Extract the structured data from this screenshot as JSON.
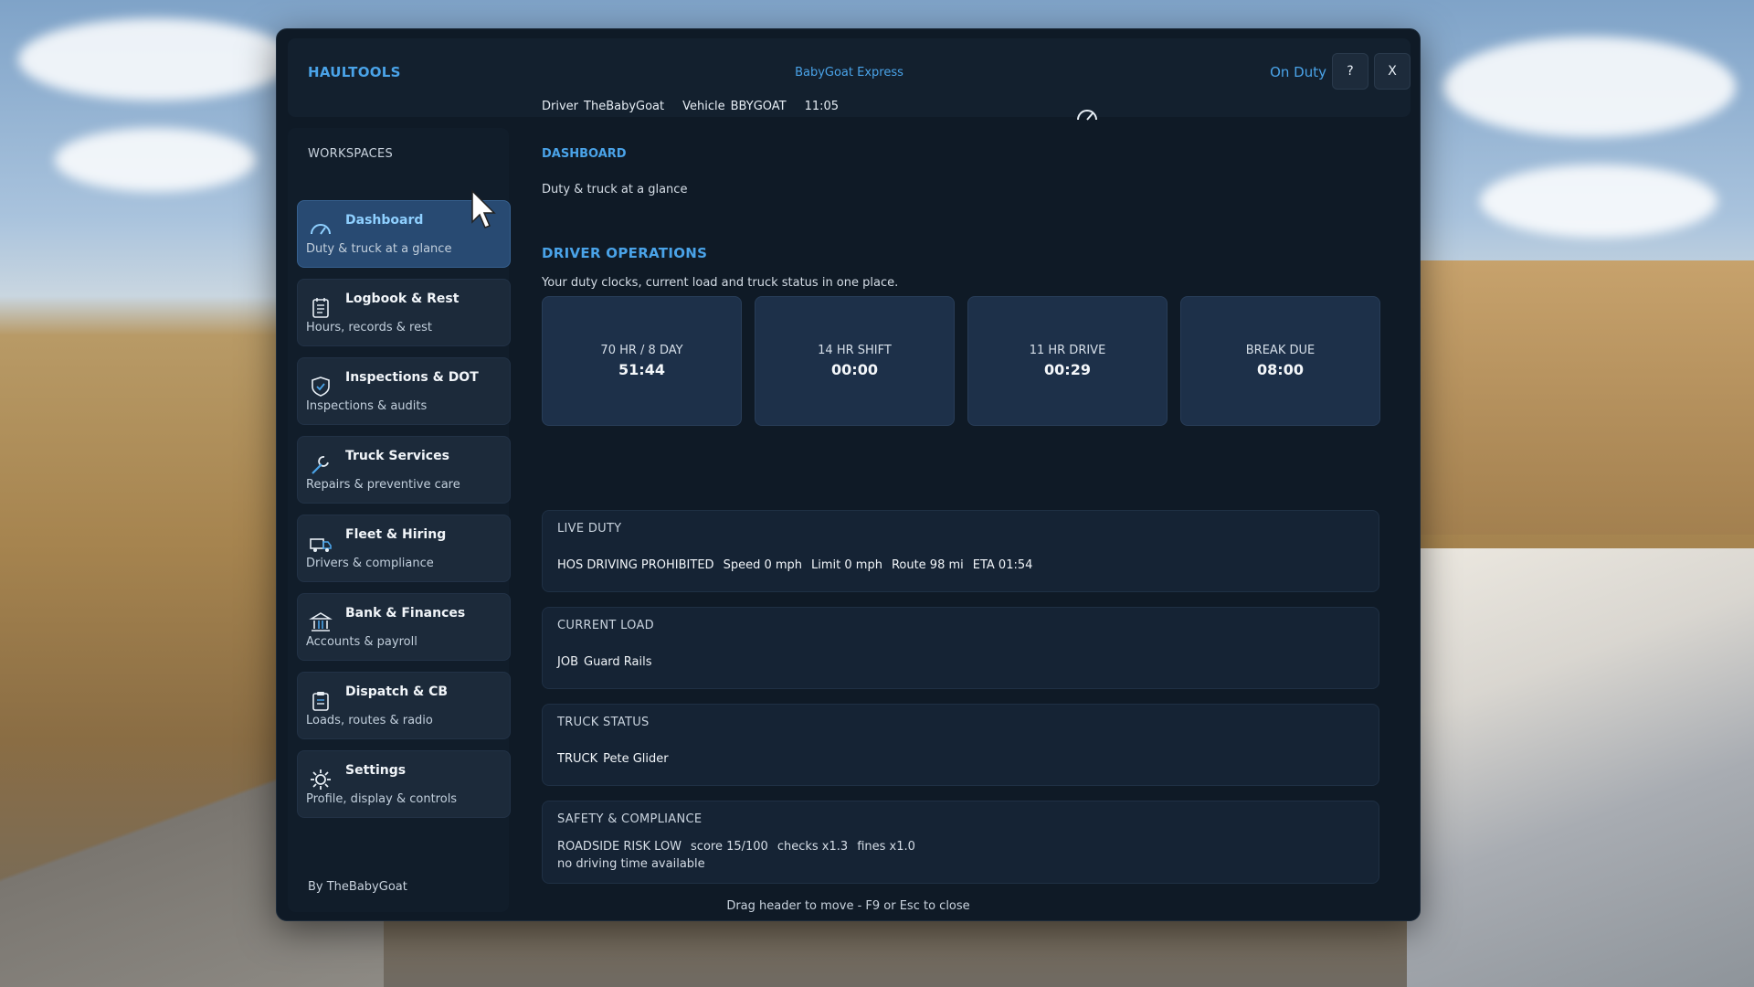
{
  "header": {
    "brand": "HAULTOOLS",
    "company": "BabyGoat Express",
    "duty_status": "On Duty",
    "help_label": "?",
    "close_label": "X",
    "driver_label": "Driver",
    "driver_value": "TheBabyGoat",
    "vehicle_label": "Vehicle",
    "vehicle_value": "BBYGOAT",
    "time": "11:05"
  },
  "sidebar": {
    "title": "WORKSPACES",
    "items": [
      {
        "title": "Dashboard",
        "subtitle": "Duty & truck at a glance",
        "icon": "gauge-icon"
      },
      {
        "title": "Logbook & Rest",
        "subtitle": "Hours, records & rest",
        "icon": "logbook-icon"
      },
      {
        "title": "Inspections & DOT",
        "subtitle": "Inspections & audits",
        "icon": "shield-check-icon"
      },
      {
        "title": "Truck Services",
        "subtitle": "Repairs & preventive care",
        "icon": "wrench-icon"
      },
      {
        "title": "Fleet & Hiring",
        "subtitle": "Drivers & compliance",
        "icon": "truck-icon"
      },
      {
        "title": "Bank & Finances",
        "subtitle": "Accounts & payroll",
        "icon": "bank-icon"
      },
      {
        "title": "Dispatch & CB",
        "subtitle": "Loads, routes & radio",
        "icon": "clipboard-icon"
      },
      {
        "title": "Settings",
        "subtitle": "Profile, display & controls",
        "icon": "gear-icon"
      }
    ],
    "byline": "By TheBabyGoat"
  },
  "main": {
    "crumb": "DASHBOARD",
    "crumb_sub": "Duty & truck at a glance",
    "section_title": "DRIVER OPERATIONS",
    "section_sub": "Your duty clocks, current load and truck status in one place.",
    "tiles": [
      {
        "label": "70 HR / 8 DAY",
        "value": "51:44"
      },
      {
        "label": "14 HR SHIFT",
        "value": "00:00"
      },
      {
        "label": "11 HR DRIVE",
        "value": "00:29"
      },
      {
        "label": "BREAK DUE",
        "value": "08:00"
      }
    ],
    "live_duty": {
      "title": "LIVE DUTY",
      "status": "HOS DRIVING PROHIBITED",
      "speed": "Speed 0 mph",
      "limit": "Limit 0 mph",
      "route": "Route 98 mi",
      "eta": "ETA 01:54"
    },
    "current_load": {
      "title": "CURRENT LOAD",
      "label": "JOB",
      "value": "Guard Rails"
    },
    "truck_status": {
      "title": "TRUCK STATUS",
      "label": "TRUCK",
      "value": "Pete Glider"
    },
    "safety": {
      "title": "SAFETY & COMPLIANCE",
      "risk": "ROADSIDE RISK LOW",
      "score": "score 15/100",
      "checks": "checks x1.3",
      "fines": "fines x1.0",
      "note": "no driving time available"
    },
    "footer_hint": "Drag header to move - F9 or Esc to close"
  },
  "colors": {
    "accent": "#4aa3e8",
    "window_bg": "#0f1a26",
    "active_nav": "#284a72"
  }
}
